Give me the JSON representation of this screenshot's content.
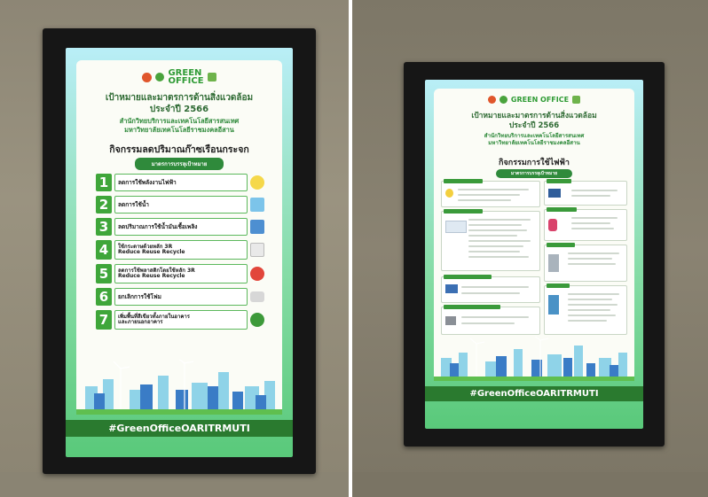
{
  "left_panel": {
    "green_office_line1": "GREEN",
    "green_office_line2": "OFFICE",
    "title_line1": "เป้าหมายและมาตรการด้านสิ่งแวดล้อม",
    "title_line2": "ประจำปี 2566",
    "sub_line1": "สำนักวิทยบริการและเทคโนโลยีสารสนเทศ",
    "sub_line2": "มหาวิทยาลัยเทคโนโลยีราชมงคลอีสาน",
    "section_title": "กิจกรรมลดปริมาณก๊าซเรือนกระจก",
    "pill": "มาตรการบรรลุเป้าหมาย",
    "items": [
      {
        "num": "1",
        "lines": [
          "ลดการใช้พลังงานไฟฟ้า"
        ]
      },
      {
        "num": "2",
        "lines": [
          "ลดการใช้น้ำ"
        ]
      },
      {
        "num": "3",
        "lines": [
          "ลดปริมาณการใช้น้ำมันเชื้อเพลิง"
        ]
      },
      {
        "num": "4",
        "lines": [
          "ใช้กระดาษด้วยหลัก 3R",
          "Reduce Reuse Recycle"
        ]
      },
      {
        "num": "5",
        "lines": [
          "ลดการใช้พลาสติกโดยใช้หลัก 3R",
          "Reduce Reuse Recycle"
        ]
      },
      {
        "num": "6",
        "lines": [
          "ยกเลิกการใช้โฟม"
        ]
      },
      {
        "num": "7",
        "lines": [
          "เพิ่มพื้นที่สีเขียวทั้งภายในอาคาร",
          "และภายนอกอาคาร"
        ]
      }
    ],
    "hashtag": "#GreenOfficeOARITRMUTI"
  },
  "right_panel": {
    "green_office": "GREEN OFFICE",
    "title_line1": "เป้าหมายและมาตรการด้านสิ่งแวดล้อม",
    "title_line2": "ประจำปี 2566",
    "sub_line1": "สำนักวิทยบริการและเทคโนโลยีสารสนเทศ",
    "sub_line2": "มหาวิทยาลัยเทคโนโลยีราชมงคลอีสาน",
    "section_title": "กิจกรรมการใช้ไฟฟ้า",
    "pill": "มาตรการบรรลุเป้าหมาย",
    "hashtag": "#GreenOfficeOARITRMUTI"
  },
  "colors": {
    "accent_green": "#3fa63a",
    "dark_green": "#2a7a2f",
    "title_green": "#2e6a33",
    "screen_sky": "#b9eef7"
  },
  "icons": [
    "logo-rmuti-icon",
    "logo-green-office-icon",
    "logo-tree-icon",
    "lightbulb-icon",
    "faucet-icon",
    "fuel-icon",
    "paper-icon",
    "plastic-icon",
    "foam-icon",
    "plant-icon",
    "wind-turbine-icon",
    "city-skyline-icon"
  ]
}
